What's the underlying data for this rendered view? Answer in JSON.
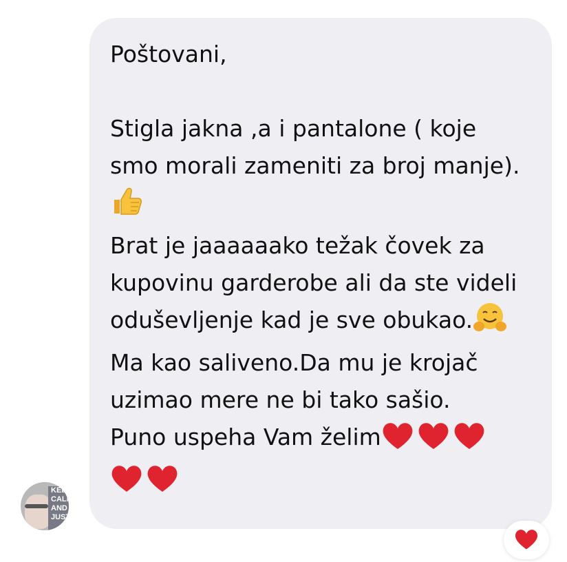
{
  "message": {
    "greeting": "Poštovani,",
    "p1": "Stigla jakna ,a i pantalone ( koje smo morali zameniti za broj manje).",
    "p1_emoji": "thumbs-up",
    "p2a": "Brat je jaaaaaako težak čovek za kupovinu garderobe ali da ste videli oduševljenje kad je sve obukao.",
    "p2_emoji": "hugging-face",
    "p2b": "Ma kao saliveno.Da mu je krojač uzimao mere ne bi tako sašio.",
    "p3": "Puno uspeha Vam želim",
    "heart_count": 5
  },
  "avatar": {
    "sign_text": "KEEP CALM AND JUST"
  },
  "reaction": {
    "emoji": "red-heart",
    "count": 1
  },
  "colors": {
    "bubble_bg": "#efeff3",
    "heart_red": "#e0242f",
    "thumbs_yellow": "#f7c33c"
  }
}
